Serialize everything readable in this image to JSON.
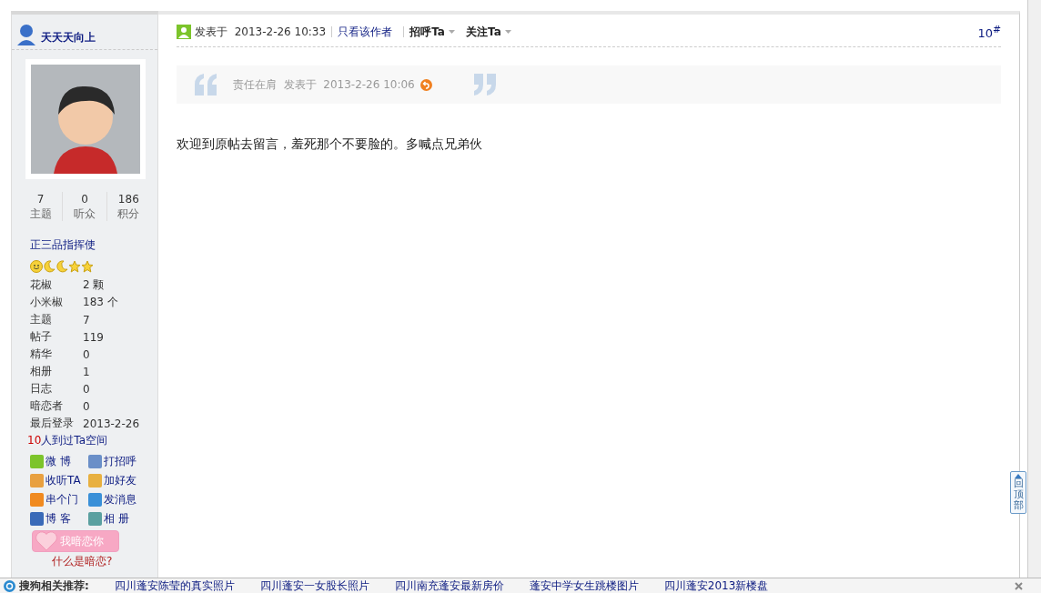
{
  "author": {
    "name": "天天天向上"
  },
  "stats": [
    {
      "value": "7",
      "label": "主题"
    },
    {
      "value": "0",
      "label": "听众"
    },
    {
      "value": "186",
      "label": "积分"
    }
  ],
  "rank": {
    "title": "正三品指挥使",
    "badges": [
      {
        "kind": "sun"
      },
      {
        "kind": "moon"
      },
      {
        "kind": "moon"
      },
      {
        "kind": "star"
      },
      {
        "kind": "star"
      }
    ]
  },
  "profile_fields": [
    {
      "label": "花椒",
      "value": "2 颗"
    },
    {
      "label": "小米椒",
      "value": "183 个"
    },
    {
      "label": "主题",
      "value": "7"
    },
    {
      "label": "帖子",
      "value": "119"
    },
    {
      "label": "精华",
      "value": "0"
    },
    {
      "label": "相册",
      "value": "1"
    },
    {
      "label": "日志",
      "value": "0"
    },
    {
      "label": "暗恋者",
      "value": "0"
    },
    {
      "label": "最后登录",
      "value": "2013-2-26"
    }
  ],
  "visitors": {
    "count": "10",
    "text": "人到过Ta空间"
  },
  "actions": [
    {
      "kind": "weibo",
      "label": "微 博"
    },
    {
      "kind": "greet",
      "label": "打招呼"
    },
    {
      "kind": "follow",
      "label": "收听TA"
    },
    {
      "kind": "friend",
      "label": "加好友"
    },
    {
      "kind": "home",
      "label": "串个门"
    },
    {
      "kind": "message",
      "label": "发消息"
    },
    {
      "kind": "blog",
      "label": "博 客"
    },
    {
      "kind": "album",
      "label": "相 册"
    }
  ],
  "crush_button": "我暗恋你",
  "crush_help": "什么是暗恋?",
  "post": {
    "posted_prefix": "发表于",
    "posted_at": "2013-2-26 10:33",
    "author_only": "只看该作者",
    "greet": "招呼Ta",
    "follow": "关注Ta",
    "floor": "10$^{#}$",
    "quote": {
      "author": "责任在肩",
      "posted_prefix": "发表于",
      "posted_at": "2013-2-26 10:06"
    },
    "message": "欢迎到原帖去留言，羞死那个不要脸的。多喊点兄弟伙"
  },
  "back_to_top": "回顶部",
  "recommend_bar": {
    "title": "搜狗相关推荐:",
    "links": [
      "四川蓬安陈莹的真实照片",
      "四川蓬安一女股长照片",
      "四川南充蓬安最新房价",
      "蓬安中学女生跳楼图片",
      "四川蓬安2013新楼盘"
    ]
  }
}
